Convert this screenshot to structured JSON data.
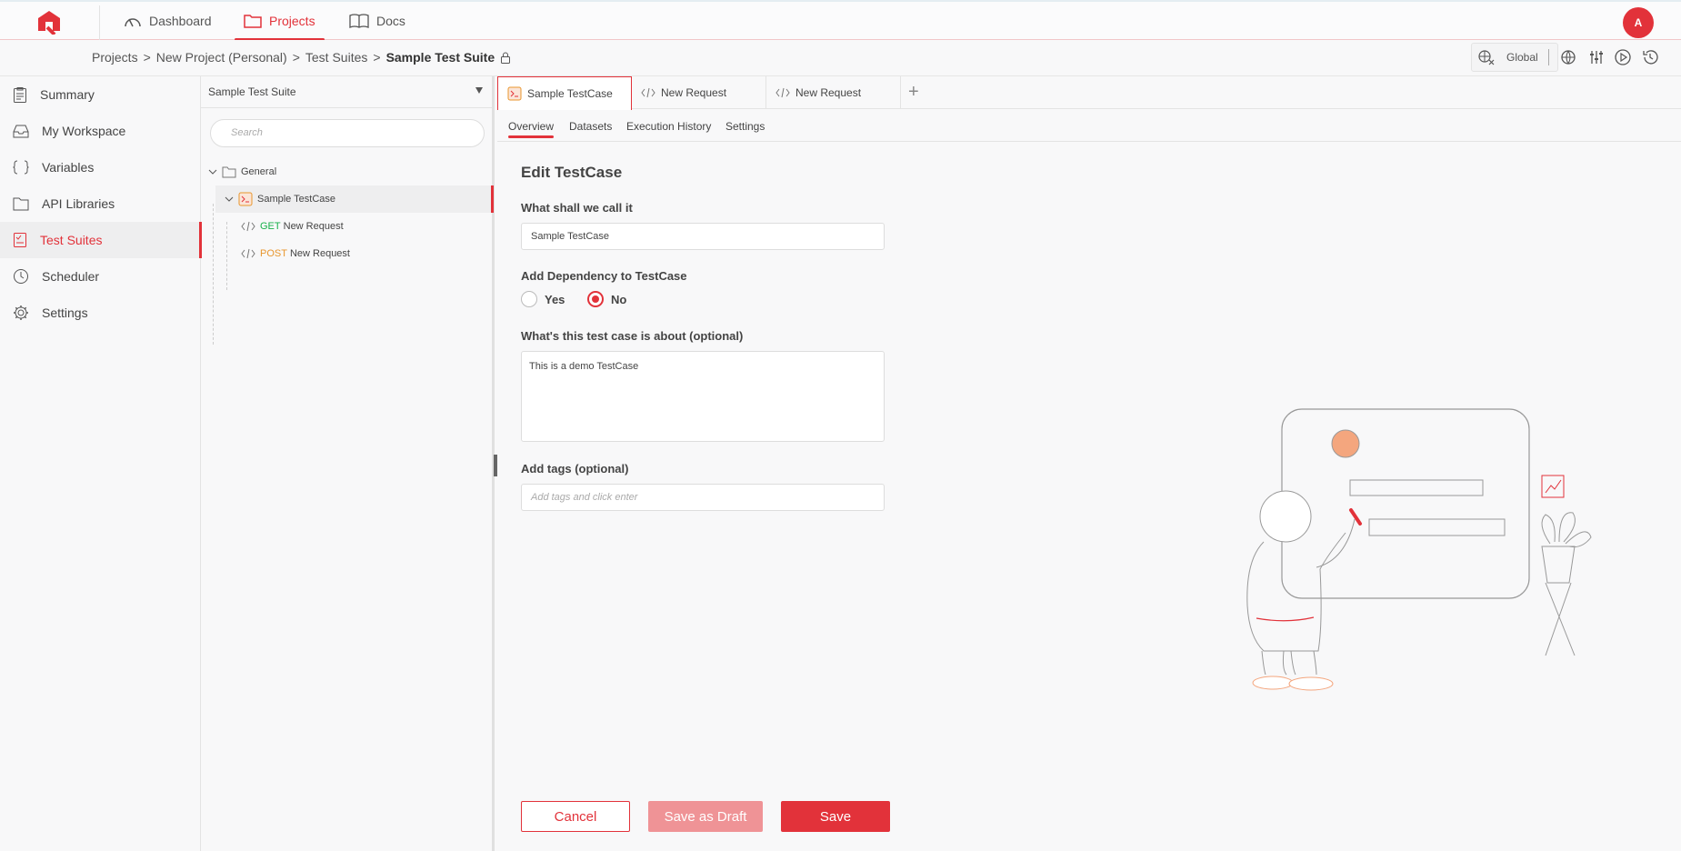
{
  "topnav": {
    "items": [
      {
        "label": "Dashboard",
        "icon": "gauge-icon"
      },
      {
        "label": "Projects",
        "icon": "folder-icon",
        "active": true
      },
      {
        "label": "Docs",
        "icon": "book-icon"
      }
    ],
    "avatar": "A"
  },
  "breadcrumb": {
    "items": [
      "Projects",
      "New Project (Personal)",
      "Test Suites"
    ],
    "current": "Sample Test Suite",
    "sep": ">"
  },
  "env": {
    "label": "Global"
  },
  "sidebar": {
    "items": [
      {
        "label": "Summary",
        "icon": "clipboard-icon"
      },
      {
        "label": "My Workspace",
        "icon": "inbox-icon"
      },
      {
        "label": "Variables",
        "icon": "braces-icon"
      },
      {
        "label": "API Libraries",
        "icon": "folder-icon"
      },
      {
        "label": "Test Suites",
        "icon": "checklist-icon",
        "active": true
      },
      {
        "label": "Scheduler",
        "icon": "clock-icon"
      },
      {
        "label": "Settings",
        "icon": "gear-icon"
      }
    ]
  },
  "tree": {
    "suite": "Sample Test Suite",
    "search_placeholder": "Search",
    "folder": "General",
    "testcase": "Sample TestCase",
    "requests": [
      {
        "method": "GET",
        "name": "New Request"
      },
      {
        "method": "POST",
        "name": "New Request"
      }
    ]
  },
  "tabs": [
    {
      "label": "Sample TestCase",
      "active": true
    },
    {
      "label": "New Request"
    },
    {
      "label": "New Request"
    }
  ],
  "subtabs": [
    "Overview",
    "Datasets",
    "Execution History",
    "Settings"
  ],
  "form": {
    "title": "Edit TestCase",
    "name_label": "What shall we call it",
    "name_value": "Sample TestCase",
    "dep_label": "Add Dependency to TestCase",
    "dep_yes": "Yes",
    "dep_no": "No",
    "dep_selected": "No",
    "desc_label": "What's this test case is about (optional)",
    "desc_value": "This is a demo TestCase",
    "tags_label": "Add tags (optional)",
    "tags_placeholder": "Add tags and click enter"
  },
  "buttons": {
    "cancel": "Cancel",
    "draft": "Save as Draft",
    "save": "Save"
  },
  "colors": {
    "accent": "#e2323a",
    "get": "#18b14a",
    "post": "#e8962e"
  }
}
